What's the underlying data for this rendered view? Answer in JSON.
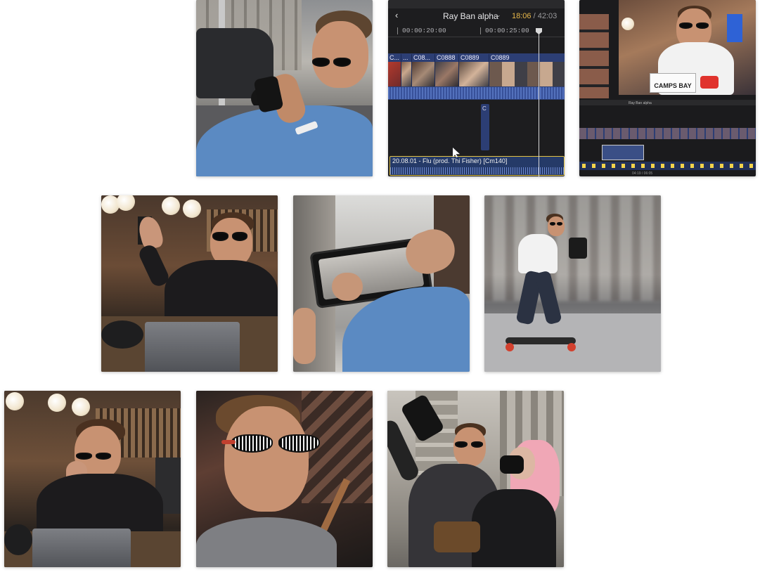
{
  "gallery": {
    "tiles": [
      {
        "id": "street-phone-filming",
        "alt": ""
      },
      {
        "id": "editing-timeline",
        "alt": ""
      },
      {
        "id": "vlog-editing-desktop",
        "alt": ""
      },
      {
        "id": "studio-waving",
        "alt": ""
      },
      {
        "id": "phone-street-view",
        "alt": ""
      },
      {
        "id": "skateboard-filming",
        "alt": ""
      },
      {
        "id": "studio-laptop",
        "alt": ""
      },
      {
        "id": "closeup-sunglasses",
        "alt": ""
      },
      {
        "id": "street-selfie",
        "alt": ""
      }
    ]
  },
  "editor": {
    "project_title": "Ray Ban alpha",
    "time_current": "18:06",
    "time_separator": " / ",
    "time_total": "42:03",
    "ruler": {
      "left": "00:00:20:00",
      "right": "00:00:25:00"
    },
    "clips": [
      "C...",
      "...",
      "C08...",
      "C0888",
      "C0889",
      "C0889"
    ],
    "connected_clip": "C",
    "audio_clip": "20.08.01 - Flu (prod. Thi Fisher) [Cm140]"
  },
  "mini_editor": {
    "sign_text": "CAMPS BAY",
    "project_title": "Ray Ban alpha",
    "time": "04:19 / 06:05"
  },
  "colors": {
    "timeline_clip": "#2c3e74",
    "timecode_accent": "#e8b84a",
    "audio_border": "#e2c243",
    "page_background": "#ffffff"
  }
}
